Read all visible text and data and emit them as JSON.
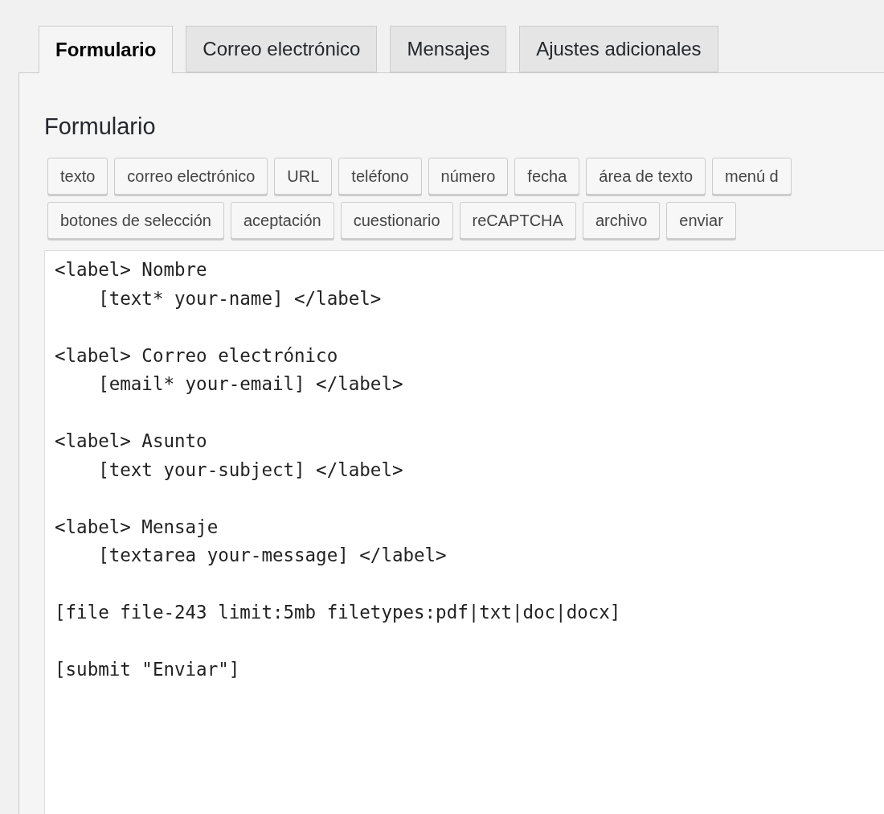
{
  "tabs": [
    {
      "label": "Formulario",
      "selected": true
    },
    {
      "label": "Correo electrónico",
      "selected": false
    },
    {
      "label": "Mensajes",
      "selected": false
    },
    {
      "label": "Ajustes adicionales",
      "selected": false
    }
  ],
  "panel": {
    "title": "Formulario",
    "tag_buttons": [
      [
        "texto",
        "correo electrónico",
        "URL",
        "teléfono",
        "número",
        "fecha",
        "área de texto",
        "menú d"
      ],
      [
        "botones de selección",
        "aceptación",
        "cuestionario",
        "reCAPTCHA",
        "archivo",
        "enviar"
      ]
    ],
    "editor_blocks": [
      [
        "<label> Nombre",
        "    [text* your-name] </label>"
      ],
      [
        "<label> Correo electrónico",
        "    [email* your-email] </label>"
      ],
      [
        "<label> Asunto",
        "    [text your-subject] </label>"
      ],
      [
        "<label> Mensaje",
        "    [textarea your-message] </label>"
      ],
      [
        "[file file-243 limit:5mb filetypes:pdf|txt|doc|docx]"
      ],
      [
        "[submit \"Enviar\"]"
      ]
    ]
  }
}
